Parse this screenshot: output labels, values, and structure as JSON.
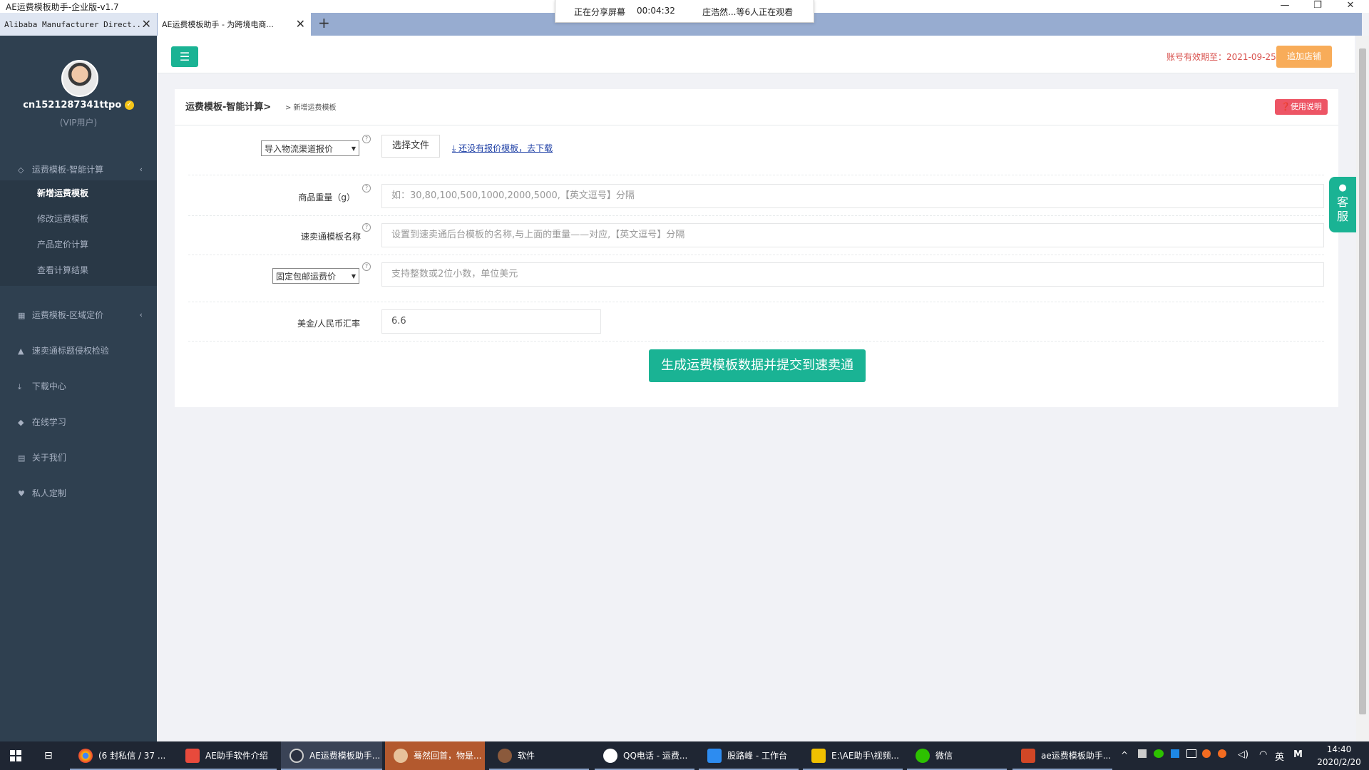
{
  "window": {
    "title": "AE运费模板助手-企业版-v1.7",
    "minimize": "—",
    "restore": "❐",
    "close": "✕"
  },
  "tabs": [
    {
      "label": "Alibaba Manufacturer Direct...",
      "close": "✕"
    },
    {
      "label": "AE运费模板助手 - 为跨境电商...",
      "close": "✕"
    }
  ],
  "new_tab": "+",
  "share_banner": {
    "status": "正在分享屏幕",
    "time": "00:04:32",
    "viewers": "庄浩然...等6人正在观看"
  },
  "user": {
    "name": "cn1521287341ttpo",
    "tier": "(VIP用户)"
  },
  "sidebar": {
    "groups": [
      {
        "label": "运费模板-智能计算",
        "icon": "diamond-icon"
      },
      {
        "label": "运费模板-区域定价",
        "icon": "calculator-icon"
      },
      {
        "label": "速卖通标题侵权检验",
        "icon": "warning-icon"
      },
      {
        "label": "下载中心",
        "icon": "download-icon"
      },
      {
        "label": "在线学习",
        "icon": "graduation-cap-icon"
      },
      {
        "label": "关于我们",
        "icon": "id-card-icon"
      },
      {
        "label": "私人定制",
        "icon": "heart-icon"
      }
    ],
    "sub_items": [
      "新增运费模板",
      "修改运费模板",
      "产品定价计算",
      "查看计算结果"
    ]
  },
  "header": {
    "expiry_label": "账号有效期至：2021-09-25",
    "add_shop": "追加店铺"
  },
  "breadcrumb": {
    "section": "运费模板-智能计算>",
    "page": "> 新增运费模板"
  },
  "help_button": "使用说明",
  "form": {
    "import_select": "导入物流渠道报价",
    "file_button": "选择文件",
    "download_link": "还没有报价模板，去下载",
    "weight_label": "商品重量（g）",
    "weight_placeholder": "如：30,80,100,500,1000,2000,5000,【英文逗号】分隔",
    "template_label": "速卖通模板名称",
    "template_placeholder": "设置到速卖通后台模板的名称,与上面的重量——对应,【英文逗号】分隔",
    "shipping_select": "固定包邮运费价",
    "shipping_placeholder": "支持整数或2位小数，单位美元",
    "rate_label": "美金/人民币汇率",
    "rate_value": "6.6",
    "submit": "生成运费模板数据并提交到速卖通"
  },
  "customer_service": "客\n服",
  "taskbar": {
    "items": [
      "(6 封私信 / 37 ...",
      "AE助手软件介绍",
      "AE运费模板助手...",
      "蓦然回首，物是...",
      "软件",
      "QQ电话 - 运费...",
      "股路峰 - 工作台",
      "E:\\AE助手\\视频...",
      "微信",
      "ae运费模板助手..."
    ],
    "ime": "英",
    "clock_time": "14:40",
    "clock_date": "2020/2/20"
  },
  "colors": {
    "accent": "#1ab394",
    "sidebar": "#2f4050",
    "warning": "#f8ac59",
    "danger": "#ed5565"
  }
}
